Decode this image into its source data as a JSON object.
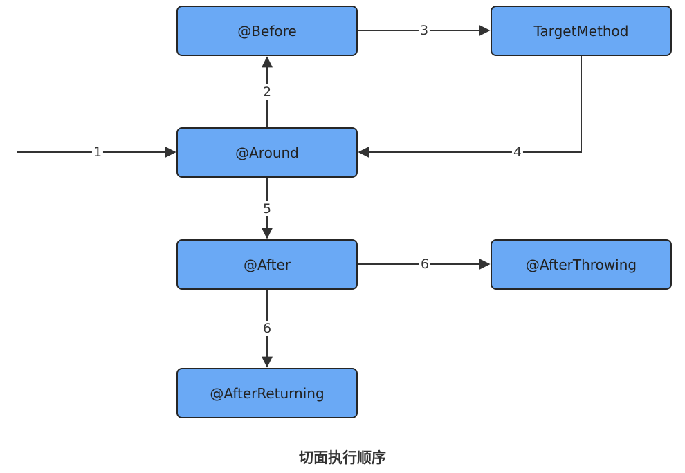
{
  "nodes": {
    "before": "@Before",
    "target": "TargetMethod",
    "around": "@Around",
    "after": "@After",
    "throwing": "@AfterThrowing",
    "returning": "@AfterReturning"
  },
  "edges": {
    "e1": "1",
    "e2": "2",
    "e3": "3",
    "e4": "4",
    "e5": "5",
    "e6a": "6",
    "e6b": "6"
  },
  "caption": "切面执行顺序",
  "colors": {
    "node_fill": "#6aa9f5",
    "node_border": "#262626",
    "edge": "#333333"
  }
}
